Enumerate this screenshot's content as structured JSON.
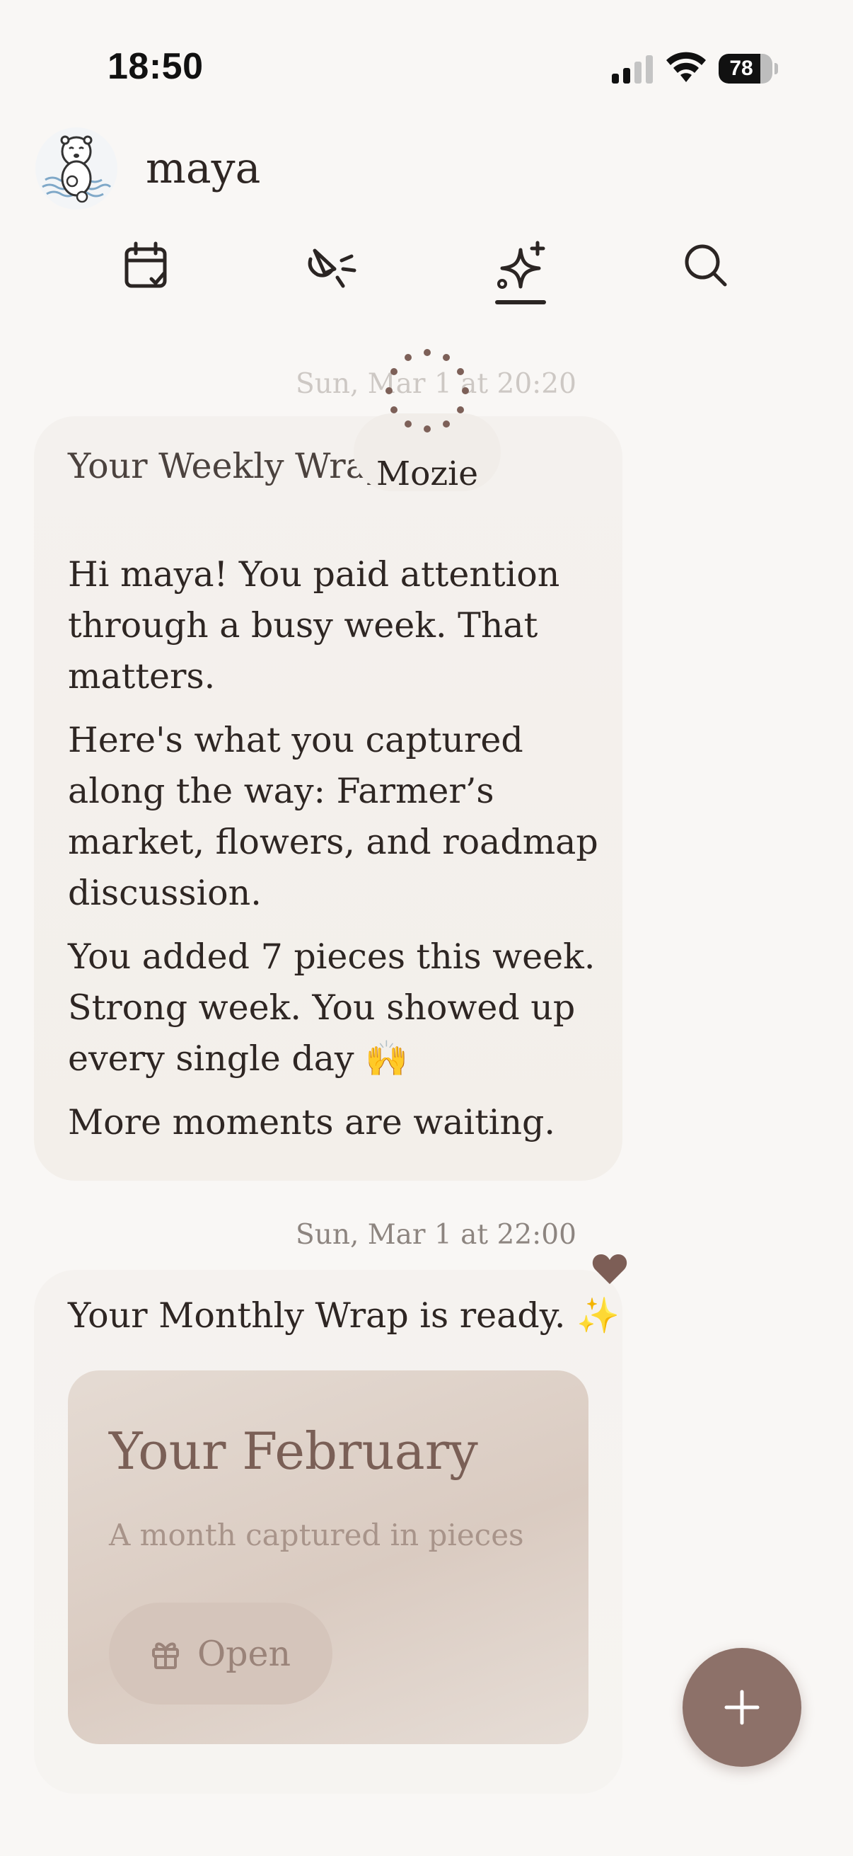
{
  "status_bar": {
    "time": "18:50",
    "battery": "78",
    "battery_level": 0.78
  },
  "profile": {
    "name": "maya",
    "avatar_icon": "otter-avatar-icon"
  },
  "tabs": [
    {
      "icon": "calendar-check-icon",
      "selected": false
    },
    {
      "icon": "sparkle-cursor-icon",
      "selected": false
    },
    {
      "icon": "sparkles-icon",
      "selected": true
    },
    {
      "icon": "search-icon",
      "selected": false
    }
  ],
  "messages": {
    "weekly": {
      "timestamp": "Sun, Mar 1 at 20:20",
      "title": "Your Weekly Wrap",
      "paragraphs": [
        "Hi maya! You paid attention through a busy week. That matters.",
        "Here's what you captured along the way: Farmer’s market, flowers, and roadmap discussion.",
        "You added 7 pieces this week. Strong week. You showed up every single day 🙌",
        "More moments are waiting."
      ]
    },
    "loading_chip": {
      "label": "Mozie"
    },
    "monthly": {
      "timestamp": "Sun, Mar 1 at 22:00",
      "text": "Your Monthly Wrap is ready. ✨",
      "card": {
        "title": "Your February",
        "subtitle": "A month captured in pieces",
        "button_label": "Open",
        "button_icon": "gift-icon"
      }
    }
  },
  "colors": {
    "accent": "#8d7169",
    "background": "#f9f7f5",
    "bubble": "#f3efeb"
  }
}
